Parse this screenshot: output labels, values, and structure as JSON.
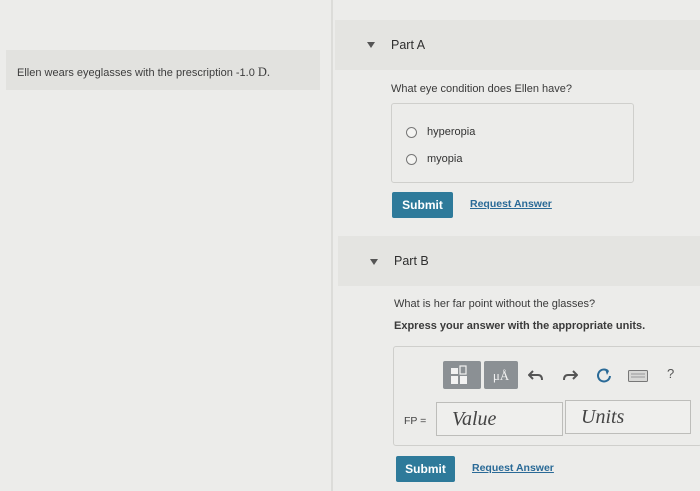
{
  "problem": {
    "text": "Ellen wears eyeglasses with the prescription -1.0",
    "unit": "D."
  },
  "partA": {
    "title": "Part A",
    "question": "What eye condition does Ellen have?",
    "choices": [
      "hyperopia",
      "myopia"
    ],
    "submit_label": "Submit",
    "request_label": "Request Answer"
  },
  "partB": {
    "title": "Part B",
    "question": "What is her far point without the glasses?",
    "instruction": "Express your answer with the appropriate units.",
    "toolbar": {
      "mu_label": "μÅ",
      "help_label": "?",
      "icons": [
        "templates-icon",
        "units-icon",
        "undo-icon",
        "redo-icon",
        "reset-icon",
        "keyboard-icon",
        "help-icon"
      ]
    },
    "fp_label": "FP =",
    "value_placeholder": "Value",
    "units_placeholder": "Units",
    "submit_label": "Submit",
    "request_label": "Request Answer"
  },
  "colors": {
    "submit_bg": "#2e7a9a",
    "link": "#2a6a97",
    "page_bg": "#ececea"
  }
}
